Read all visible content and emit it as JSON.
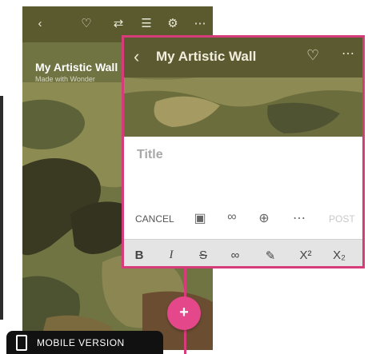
{
  "phone": {
    "title": "My Artistic Wall",
    "subtitle": "Made with Wonder",
    "toolbar_icons": [
      "back-icon",
      "heart-icon",
      "repeat-icon",
      "people-icon",
      "gear-icon",
      "more-icon"
    ]
  },
  "card": {
    "title": "My Artistic Wall",
    "title_placeholder": "Title",
    "cancel_label": "CANCEL",
    "post_label": "POST",
    "action_icons": [
      "image-icon",
      "link-icon",
      "zoom-icon",
      "more-icon"
    ],
    "format": {
      "bold": "B",
      "italic": "I",
      "strike": "S",
      "superscript": "X²",
      "subscript": "X₂"
    }
  },
  "fab": {
    "label": "+"
  },
  "badge": {
    "label": "MOBILE VERSION"
  },
  "colors": {
    "accent": "#d63c79",
    "header": "#5b5a31",
    "fab": "#e4488b"
  }
}
